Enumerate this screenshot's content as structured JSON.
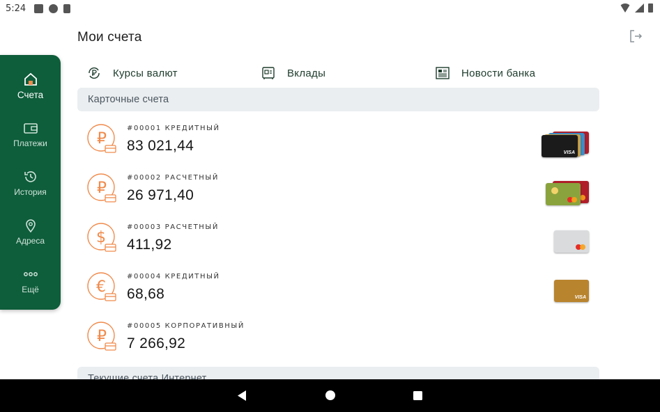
{
  "status_bar": {
    "time": "5:24"
  },
  "header": {
    "title": "Мои счета"
  },
  "sidenav": {
    "items": [
      {
        "label": "Счета",
        "icon": "home-icon",
        "active": true
      },
      {
        "label": "Платежи",
        "icon": "wallet-icon",
        "active": false
      },
      {
        "label": "История",
        "icon": "history-icon",
        "active": false
      },
      {
        "label": "Адреса",
        "icon": "location-pin-icon",
        "active": false
      },
      {
        "label": "Ещё",
        "icon": "more-dots-icon",
        "active": false
      }
    ]
  },
  "quick_links": [
    {
      "label": "Курсы валют",
      "icon": "currency-rates-icon"
    },
    {
      "label": "Вклады",
      "icon": "safe-icon"
    },
    {
      "label": "Новости банка",
      "icon": "news-icon"
    }
  ],
  "sections": [
    {
      "title": "Карточные счета"
    },
    {
      "title": "Текущие счета Интернет"
    }
  ],
  "accounts": [
    {
      "name": "#00001 КРЕДИТНЫЙ",
      "amount": "83 021,44",
      "currency_symbol": "₽"
    },
    {
      "name": "#00002 РАСЧЕТНЫЙ",
      "amount": "26 971,40",
      "currency_symbol": "₽"
    },
    {
      "name": "#00003 РАСЧЕТНЫЙ",
      "amount": "411,92",
      "currency_symbol": "$"
    },
    {
      "name": "#00004 КРЕДИТНЫЙ",
      "amount": "68,68",
      "currency_symbol": "€"
    },
    {
      "name": "#00005 КОРПОРАТИВНЫЙ",
      "amount": "7 266,92",
      "currency_symbol": "₽"
    }
  ],
  "card_labels": {
    "visa": "VISA"
  },
  "colors": {
    "brand_green": "#0e5d3b",
    "accent_orange": "#f08a4b",
    "section_bg": "#ebeef0"
  }
}
